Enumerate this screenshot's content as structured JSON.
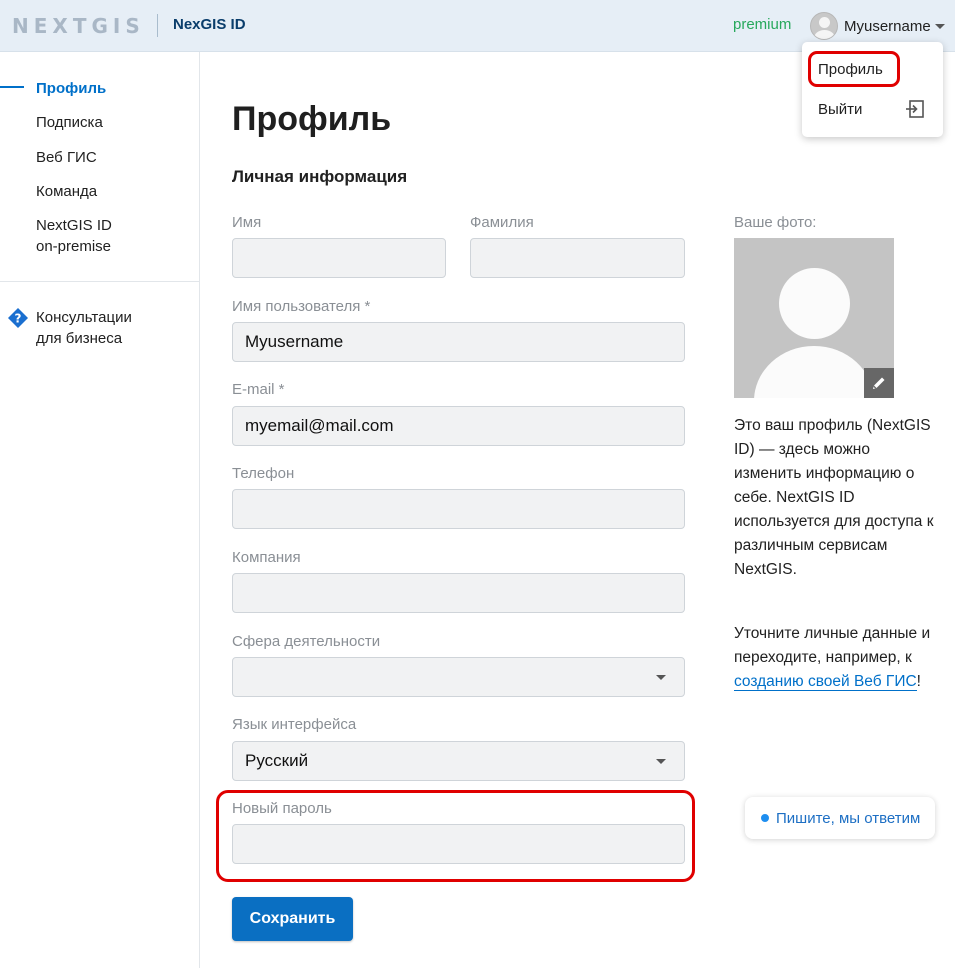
{
  "header": {
    "logo_text": "NEXTGIS",
    "product_name": "NexGIS ID",
    "plan_badge": "premium",
    "username": "Myusername",
    "colors": {
      "plan": "#27a85c",
      "accent": "#0070c9"
    }
  },
  "user_menu": {
    "items": [
      {
        "label": "Профиль",
        "icon": null
      },
      {
        "label": "Выйти",
        "icon": "logout-icon"
      }
    ]
  },
  "sidebar": {
    "items": [
      {
        "label": "Профиль",
        "active": true
      },
      {
        "label": "Подписка"
      },
      {
        "label": "Веб ГИС"
      },
      {
        "label": "Команда"
      },
      {
        "label_line1": "NextGIS ID",
        "label_line2": "on-premise"
      }
    ],
    "business": {
      "line1": "Консультации",
      "line2": "для бизнеса",
      "icon": "help-diamond-icon"
    }
  },
  "main": {
    "title": "Профиль",
    "section_title": "Личная информация",
    "fields": {
      "first_name": {
        "label": "Имя",
        "value": ""
      },
      "last_name": {
        "label": "Фамилия",
        "value": ""
      },
      "username": {
        "label": "Имя пользователя *",
        "value": "Myusername"
      },
      "email": {
        "label": "E-mail *",
        "value": "myemail@mail.com"
      },
      "phone": {
        "label": "Телефон",
        "value": ""
      },
      "company": {
        "label": "Компания",
        "value": ""
      },
      "sphere": {
        "label": "Сфера деятельности",
        "value": ""
      },
      "language": {
        "label": "Язык интерфейса",
        "value": "Русский"
      },
      "new_password": {
        "label": "Новый пароль",
        "value": ""
      }
    },
    "save_label": "Сохранить"
  },
  "photo": {
    "label": "Ваше фото:",
    "edit_icon": "pencil-icon"
  },
  "info": {
    "p1": "Это ваш профиль (NextGIS ID) — здесь можно изменить информацию о себе. NextGIS ID используется для доступа к различным сервисам NextGIS.",
    "p2_before": "Уточните личные данные и переходите, например, к ",
    "p2_link": "созданию своей Веб ГИС",
    "p2_after": "!"
  },
  "chat": {
    "label": "Пишите, мы ответим"
  }
}
